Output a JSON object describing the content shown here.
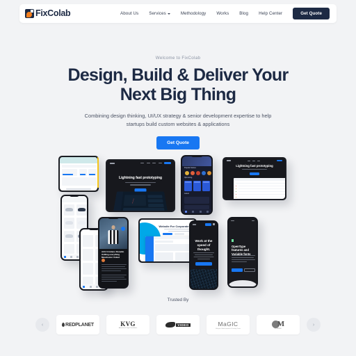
{
  "site": {
    "brand": "FixColab",
    "logo_icon": "fixcolab-mark-icon",
    "accent_blue": "#1877f2",
    "navy": "#1d2a44",
    "orange": "#f4801f",
    "page_bg": "#f2f3f5"
  },
  "navbar": {
    "links": [
      {
        "label": "About Us",
        "has_dropdown": false
      },
      {
        "label": "Services",
        "has_dropdown": true
      },
      {
        "label": "Methodology",
        "has_dropdown": false
      },
      {
        "label": "Works",
        "has_dropdown": false
      },
      {
        "label": "Blog",
        "has_dropdown": false
      },
      {
        "label": "Help Center",
        "has_dropdown": false
      }
    ],
    "cta_label": "Get Quote"
  },
  "hero": {
    "eyebrow": "Welcome to FixColab",
    "headline": "Design, Build & Deliver Your Next Big Thing",
    "subtitle": "Combining design thinking, UI/UX strategy & senior development expertise to help startups build custom websites & applications",
    "cta_label": "Get Quote"
  },
  "showcase": {
    "devices": [
      {
        "name": "dashboard-tablet",
        "caption": ""
      },
      {
        "name": "prototyping-tablet",
        "caption": "Lightning fast prototyping"
      },
      {
        "name": "ecommerce-phone",
        "caption": "Products"
      },
      {
        "name": "sports-news-phone",
        "caption": "Ahh! Cristiano Ronaldo thrilling everything Manchester United"
      },
      {
        "name": "corporate-tablet",
        "caption": "Website For Corporate"
      },
      {
        "name": "speed-of-thought-phone",
        "caption": "Work at the speed of thought."
      },
      {
        "name": "opentype-phone",
        "caption": "OpenType features and Variable fonts"
      },
      {
        "name": "data-table-tablet",
        "caption": "Lightning fast prototyping"
      },
      {
        "name": "gaming-phone",
        "caption": "Popular Games"
      }
    ]
  },
  "trusted": {
    "label": "Trusted By",
    "prev_icon": "chevron-left-icon",
    "next_icon": "chevron-right-icon",
    "logos": [
      {
        "name": "redplanet",
        "text": "REDPLANET",
        "sub": ""
      },
      {
        "name": "kvg",
        "text": "KVG",
        "sub": "Advocates & Legal Consultants"
      },
      {
        "name": "badge-logo",
        "text": "VIDEO",
        "sub": ""
      },
      {
        "name": "magic",
        "text": "MaGIC",
        "sub": "Malaysian Global Innovation & Creativity Centre"
      },
      {
        "name": "m-circle",
        "text": "M",
        "sub": "MY BRAND"
      }
    ]
  }
}
